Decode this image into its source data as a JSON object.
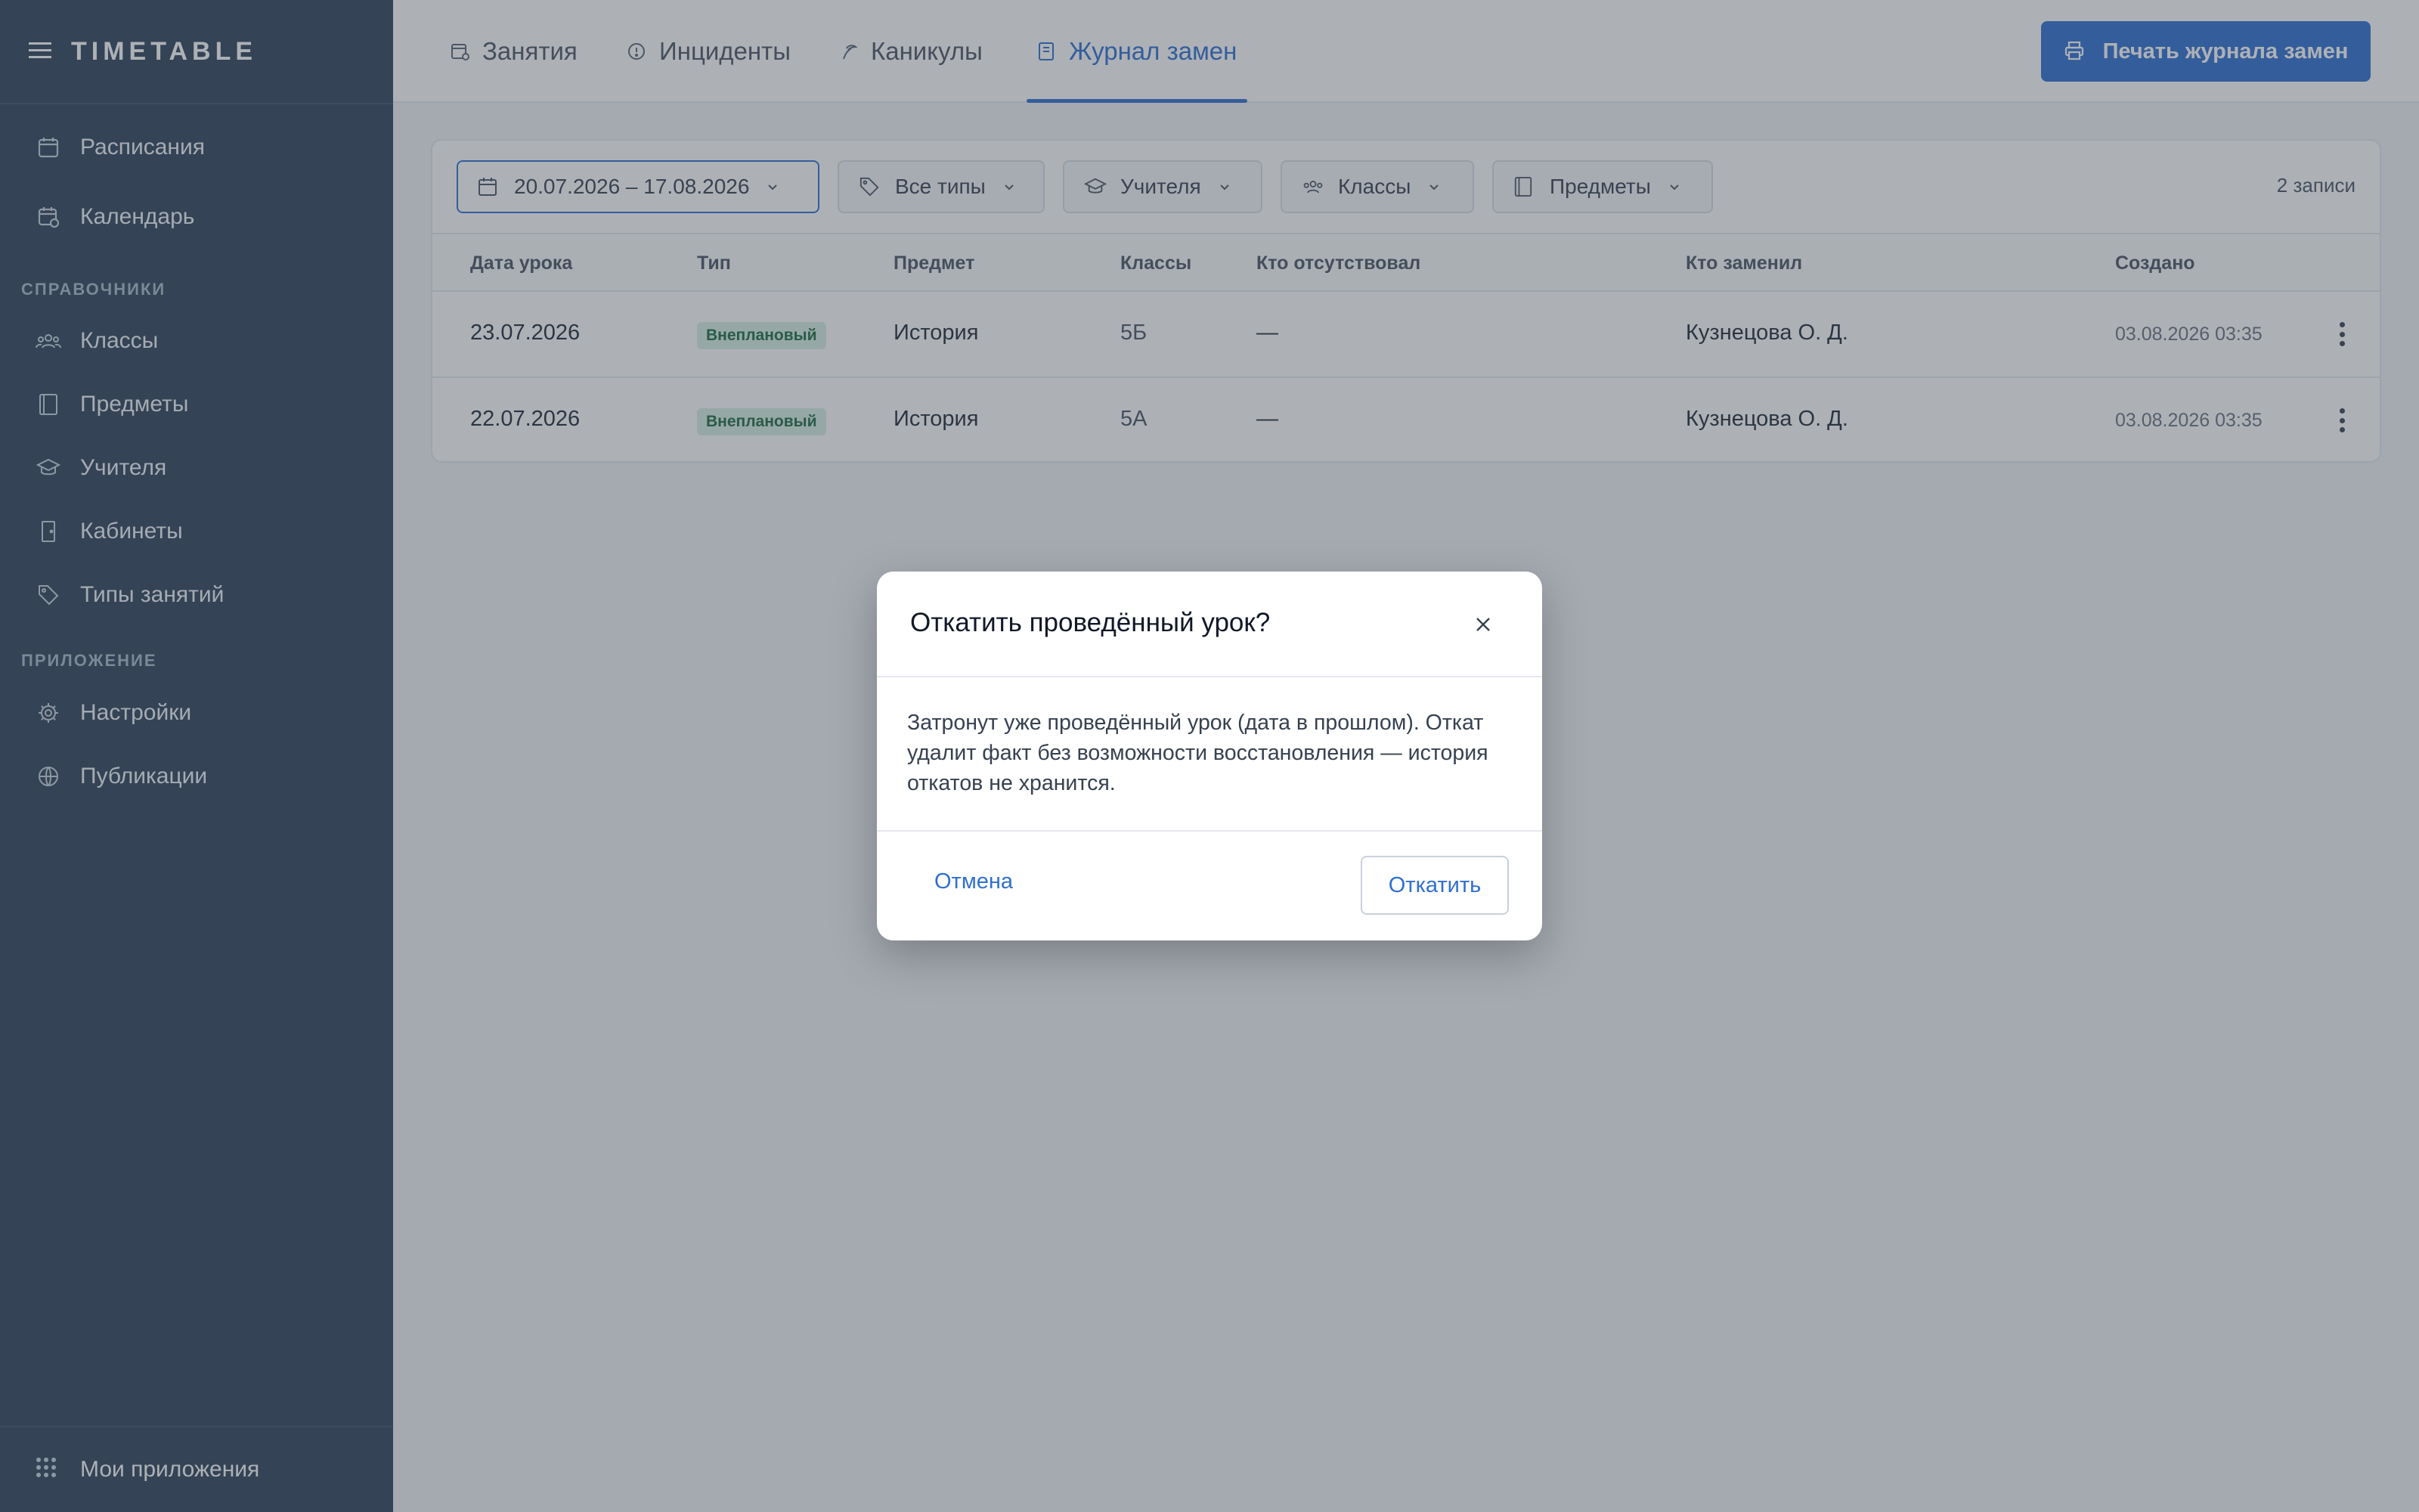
{
  "app": {
    "title": "TIMETABLE"
  },
  "sidebar": {
    "items": [
      {
        "label": "Расписания",
        "icon": "calendar-icon"
      },
      {
        "label": "Календарь",
        "icon": "calendar-clock-icon"
      }
    ],
    "section_references": "СПРАВОЧНИКИ",
    "reference_items": [
      {
        "label": "Классы",
        "icon": "users-icon"
      },
      {
        "label": "Предметы",
        "icon": "book-icon"
      },
      {
        "label": "Учителя",
        "icon": "graduation-cap-icon"
      },
      {
        "label": "Кабинеты",
        "icon": "door-icon"
      },
      {
        "label": "Типы занятий",
        "icon": "tag-icon"
      }
    ],
    "section_app": "ПРИЛОЖЕНИЕ",
    "app_items": [
      {
        "label": "Настройки",
        "icon": "gear-icon"
      },
      {
        "label": "Публикации",
        "icon": "globe-icon"
      }
    ],
    "bottom": {
      "label": "Мои приложения",
      "icon": "apps-grid-icon"
    }
  },
  "tabs": [
    {
      "label": "Занятия",
      "icon": "calendar-clock-icon",
      "active": false
    },
    {
      "label": "Инциденты",
      "icon": "alert-circle-icon",
      "active": false
    },
    {
      "label": "Каникулы",
      "icon": "palm-icon",
      "active": false
    },
    {
      "label": "Журнал замен",
      "icon": "journal-icon",
      "active": true
    }
  ],
  "toolbar": {
    "print_label": "Печать журнала замен"
  },
  "filters": {
    "date_range": "20.07.2026 – 17.08.2026",
    "types": "Все типы",
    "teachers": "Учителя",
    "classes": "Классы",
    "subjects": "Предметы",
    "records_count": "2 записи"
  },
  "table": {
    "headers": [
      "Дата урока",
      "Тип",
      "Предмет",
      "Классы",
      "Кто отсутствовал",
      "Кто заменил",
      "Создано"
    ],
    "rows": [
      {
        "date": "23.07.2026",
        "type": "Внеплановый",
        "subject": "История",
        "class": "5Б",
        "absent": "—",
        "substitute": "Кузнецова О. Д.",
        "created": "03.08.2026 03:35"
      },
      {
        "date": "22.07.2026",
        "type": "Внеплановый",
        "subject": "История",
        "class": "5А",
        "absent": "—",
        "substitute": "Кузнецова О. Д.",
        "created": "03.08.2026 03:35"
      }
    ]
  },
  "modal": {
    "title": "Откатить проведённый урок?",
    "body": "Затронут уже проведённый урок (дата в прошлом). Откат удалит факт без возможности восстановления — история откатов не хранится.",
    "cancel_label": "Отмена",
    "confirm_label": "Откатить"
  },
  "colors": {
    "accent": "#2f6fd0",
    "sidebar": "#2f4359",
    "badge_bg": "#d8f0e2",
    "badge_text": "#1d6b43"
  }
}
